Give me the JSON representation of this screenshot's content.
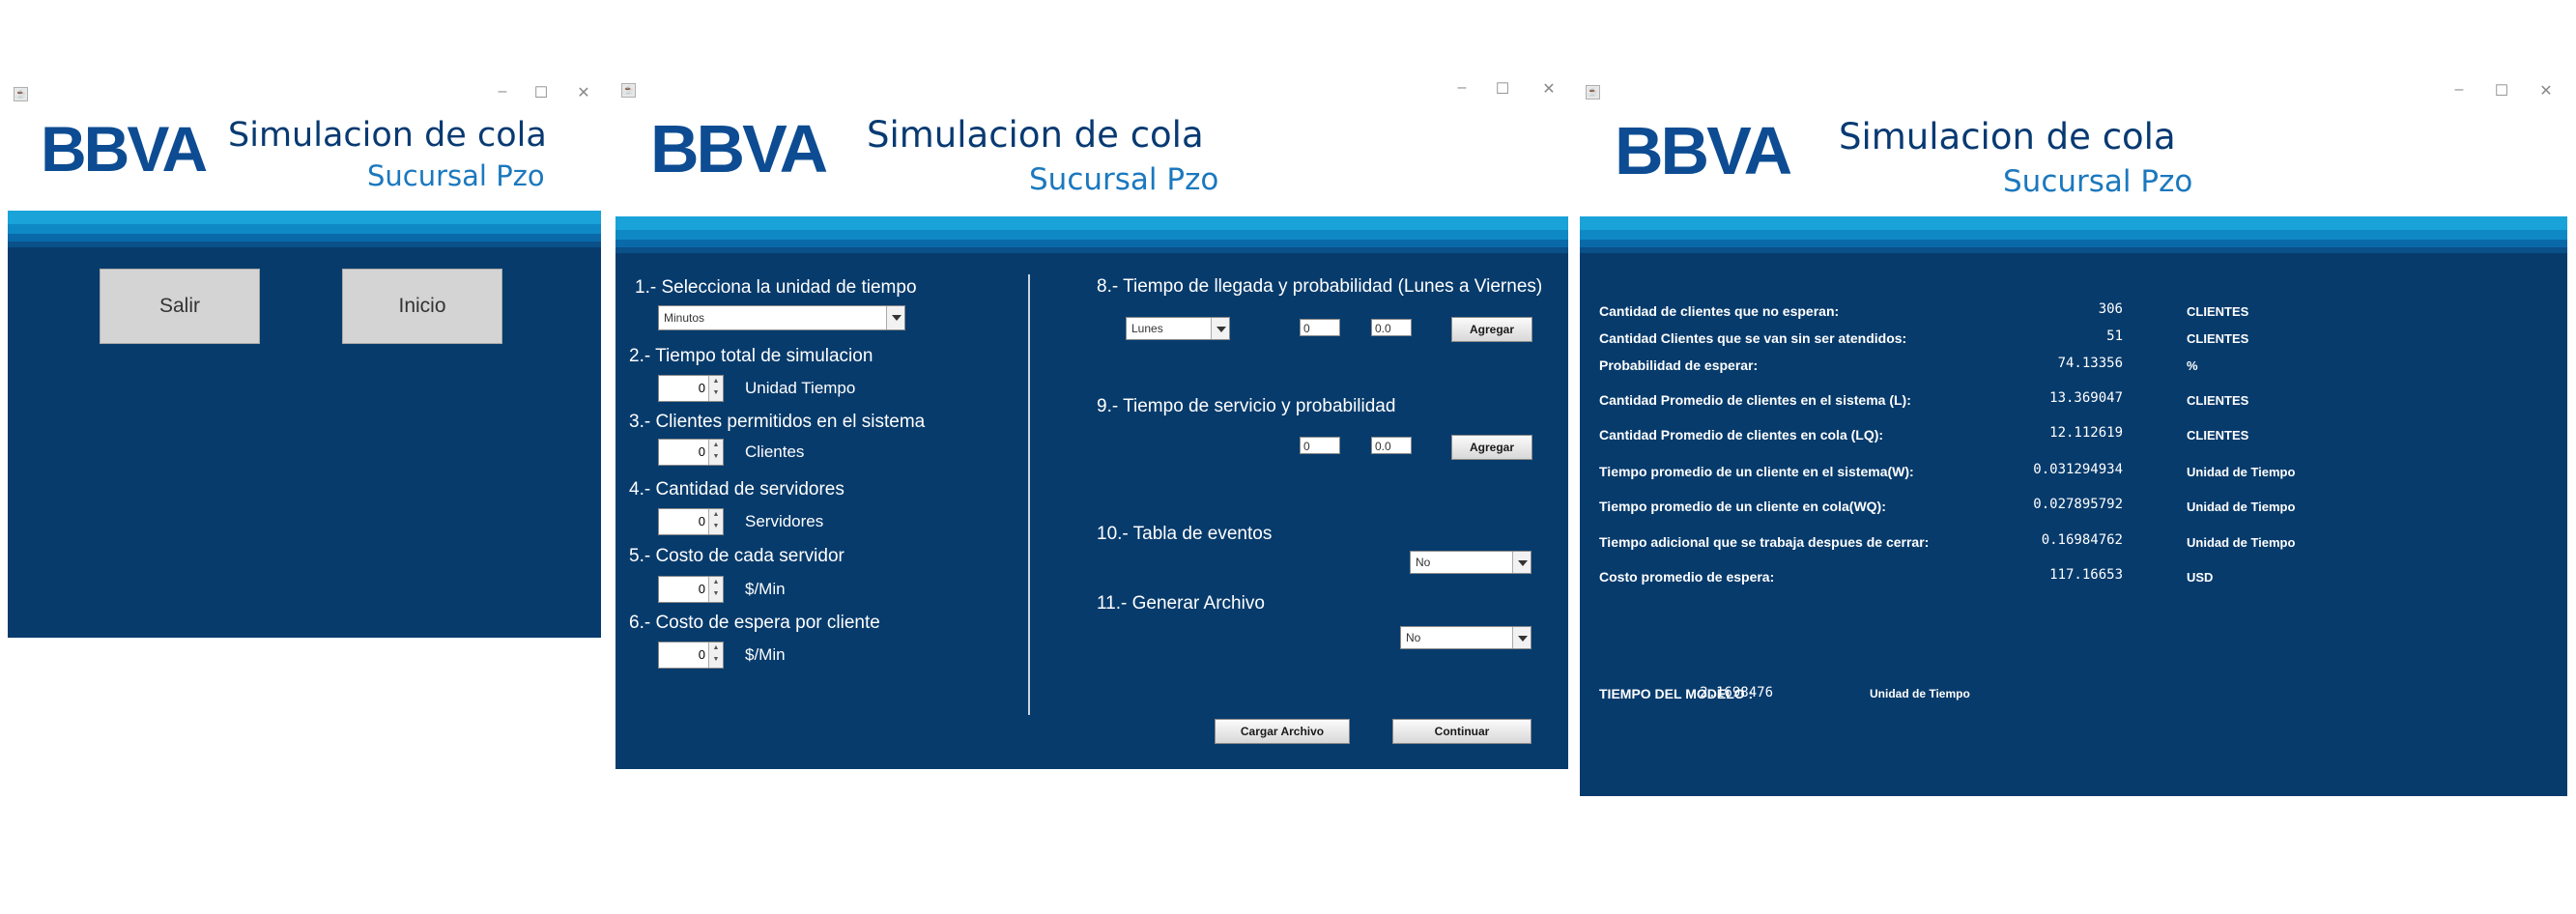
{
  "brand": {
    "logo_text": "BBVA",
    "title": "Simulacion de cola",
    "subtitle": "Sucursal Pzo"
  },
  "window_controls": {
    "minimize": "–",
    "maximize": "☐",
    "close": "✕"
  },
  "colors": {
    "panel_bg": "#073b6c",
    "brand_blue": "#0d4c92",
    "band_cyan": "#1aa3d9"
  },
  "window1": {
    "buttons": {
      "salir": "Salir",
      "inicio": "Inicio"
    }
  },
  "window2": {
    "left": {
      "q1": "1.- Selecciona la unidad de tiempo",
      "unit_select": "Minutos",
      "q2": "2.- Tiempo total de simulacion",
      "q2_value": "0",
      "q2_unit": "Unidad Tiempo",
      "q3": "3.- Clientes permitidos en el sistema",
      "q3_value": "0",
      "q3_unit": "Clientes",
      "q4": "4.- Cantidad de servidores",
      "q4_value": "0",
      "q4_unit": "Servidores",
      "q5": "5.- Costo de cada servidor",
      "q5_value": "0",
      "q5_unit": "$/Min",
      "q6": "6.- Costo de espera por cliente",
      "q6_value": "0",
      "q6_unit": "$/Min"
    },
    "right": {
      "q8": "8.- Tiempo de llegada y probabilidad (Lunes a Viernes)",
      "q8_day": "Lunes",
      "q8_time": "0",
      "q8_prob": "0.0",
      "q8_add": "Agregar",
      "q9": "9.- Tiempo de servicio y probabilidad",
      "q9_time": "0",
      "q9_prob": "0.0",
      "q9_add": "Agregar",
      "q10": "10.- Tabla de eventos",
      "q10_select": "No",
      "q11": "11.- Generar Archivo",
      "q11_select": "No",
      "load_button": "Cargar Archivo",
      "continue_button": "Continuar"
    }
  },
  "window3": {
    "results": [
      {
        "label": "Cantidad de clientes que no esperan:",
        "value": "306",
        "unit": "CLIENTES"
      },
      {
        "label": "Cantidad Clientes que se van sin ser atendidos:",
        "value": "51",
        "unit": "CLIENTES"
      },
      {
        "label": "Probabilidad de esperar:",
        "value": "74.13356",
        "unit": "%"
      },
      {
        "label": "Cantidad Promedio de clientes en el sistema (L):",
        "value": "13.369047",
        "unit": "CLIENTES"
      },
      {
        "label": "Cantidad Promedio de clientes en cola (LQ):",
        "value": "12.112619",
        "unit": "CLIENTES"
      },
      {
        "label": "Tiempo promedio de un cliente en el sistema(W):",
        "value": "0.031294934",
        "unit": "Unidad de Tiempo"
      },
      {
        "label": "Tiempo promedio de un cliente en cola(WQ):",
        "value": "0.027895792",
        "unit": "Unidad de Tiempo"
      },
      {
        "label": "Tiempo adicional que se trabaja despues de cerrar:",
        "value": "0.16984762",
        "unit": "Unidad de Tiempo"
      },
      {
        "label": "Costo promedio de espera:",
        "value": "117.16653",
        "unit": "USD"
      }
    ],
    "model_time_label": "TIEMPO DEL MODELO :",
    "model_time_value": "2.1698476",
    "model_time_unit": "Unidad de Tiempo"
  }
}
